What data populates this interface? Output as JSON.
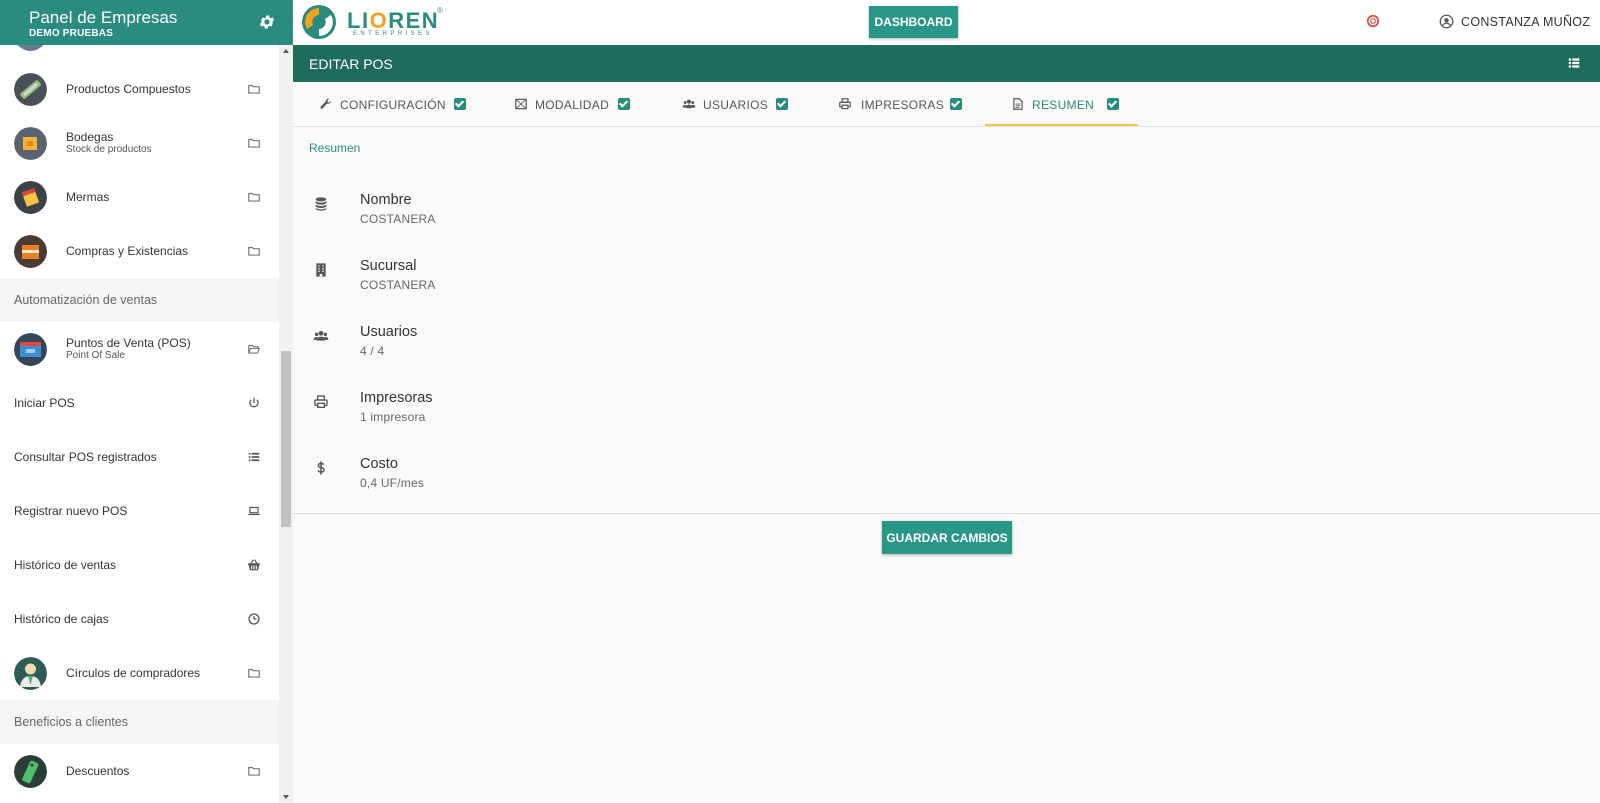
{
  "sidebar": {
    "title": "Panel de Empresas",
    "subtitle": "DEMO PRUEBAS",
    "items": [
      {
        "label": "Productos Compuestos",
        "sub": "",
        "icon": "folder-icon"
      },
      {
        "label": "Bodegas",
        "sub": "Stock de productos",
        "icon": "folder-icon"
      },
      {
        "label": "Mermas",
        "sub": "",
        "icon": "folder-icon"
      },
      {
        "label": "Compras y Existencias",
        "sub": "",
        "icon": "folder-icon"
      }
    ],
    "section_sales": "Automatización de ventas",
    "pos": {
      "label": "Puntos de Venta (POS)",
      "sub": "Point Of Sale",
      "icon": "folder-open-icon"
    },
    "pos_items": [
      {
        "label": "Iniciar POS",
        "icon": "power-icon"
      },
      {
        "label": "Consultar POS registrados",
        "icon": "list-icon"
      },
      {
        "label": "Registrar nuevo POS",
        "icon": "laptop-icon"
      },
      {
        "label": "Histórico de ventas",
        "icon": "basket-icon"
      },
      {
        "label": "Histórico de cajas",
        "icon": "clock-icon"
      }
    ],
    "circles": {
      "label": "Círculos de compradores",
      "icon": "folder-icon"
    },
    "section_benefits": "Beneficios a clientes",
    "discounts": {
      "label": "Descuentos",
      "icon": "folder-icon"
    }
  },
  "topbar": {
    "logo_text": "LIOREN",
    "logo_sub": "ENTERPRISES",
    "dashboard_label": "DASHBOARD",
    "user_name": "CONSTANZA MUÑOZ"
  },
  "panel": {
    "title": "EDITAR POS"
  },
  "tabs": [
    {
      "label": "CONFIGURACIÓN",
      "icon": "wrench-icon",
      "checked": true
    },
    {
      "label": "MODALIDAD",
      "icon": "modality-icon",
      "checked": true
    },
    {
      "label": "USUARIOS",
      "icon": "users-icon",
      "checked": true
    },
    {
      "label": "IMPRESORAS",
      "icon": "printer-icon",
      "checked": true
    },
    {
      "label": "RESUMEN",
      "icon": "document-icon",
      "checked": true,
      "active": true
    }
  ],
  "summary": {
    "section_label": "Resumen",
    "rows": [
      {
        "title": "Nombre",
        "value": "COSTANERA",
        "icon": "database-icon"
      },
      {
        "title": "Sucursal",
        "value": "COSTANERA",
        "icon": "building-icon"
      },
      {
        "title": "Usuarios",
        "value": "4 / 4",
        "icon": "users-icon"
      },
      {
        "title": "Impresoras",
        "value": "1 impresora",
        "icon": "printer-icon"
      },
      {
        "title": "Costo",
        "value": "0,4 UF/mes",
        "icon": "dollar-icon"
      }
    ]
  },
  "save_label": "GUARDAR CAMBIOS",
  "colors": {
    "primary": "#2a8c7f",
    "header_dark": "#1f6b5c",
    "accent_underline": "#f4c542"
  }
}
